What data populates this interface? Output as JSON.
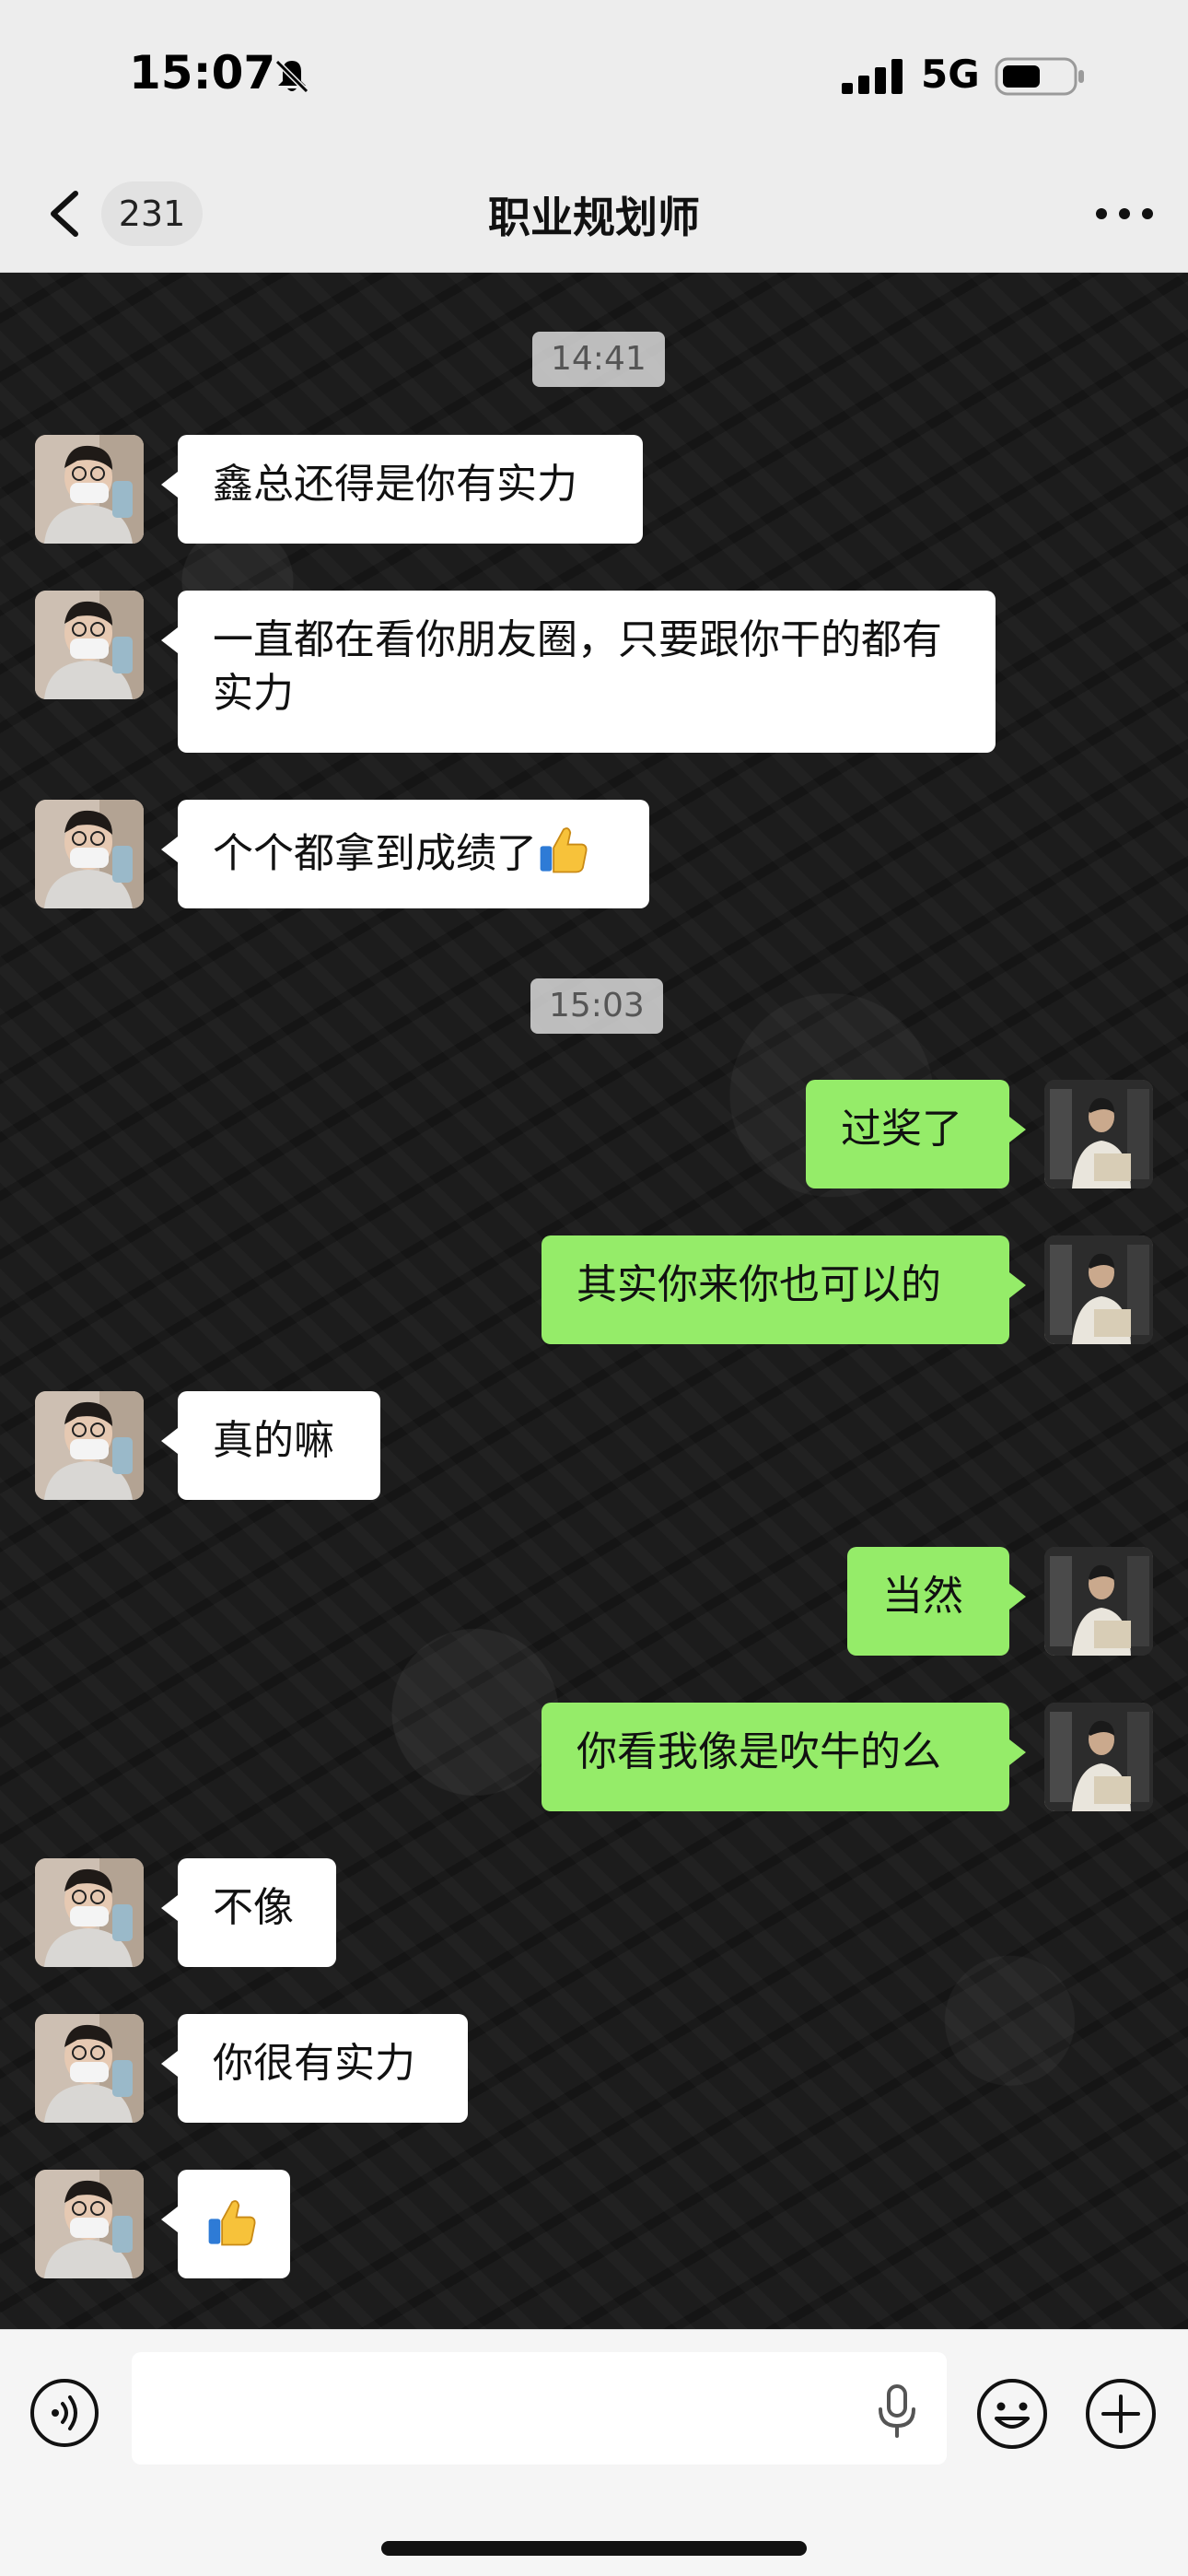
{
  "status_bar": {
    "time": "15:07",
    "network": "5G",
    "icons": [
      "bell-slash-icon",
      "signal-icon",
      "battery-icon"
    ]
  },
  "nav": {
    "unread_count": "231",
    "title": "职业规划师",
    "icons": [
      "chevron-left-icon",
      "more-dots-icon"
    ]
  },
  "chat": {
    "timestamps": [
      "14:41",
      "15:03"
    ],
    "messages": [
      {
        "from": "friend",
        "text": "鑫总还得是你有实力"
      },
      {
        "from": "friend",
        "text": "一直都在看你朋友圈，只要跟你干的都有实力"
      },
      {
        "from": "friend",
        "text": "个个都拿到成绩了",
        "emoji": "thumbs-up"
      },
      {
        "from": "self",
        "text": "过奖了"
      },
      {
        "from": "self",
        "text": "其实你来你也可以的"
      },
      {
        "from": "friend",
        "text": "真的嘛"
      },
      {
        "from": "self",
        "text": "当然"
      },
      {
        "from": "self",
        "text": "你看我像是吹牛的么"
      },
      {
        "from": "friend",
        "text": "不像"
      },
      {
        "from": "friend",
        "text": "你很有实力"
      },
      {
        "from": "friend",
        "text": "",
        "emoji": "thumbs-up"
      }
    ]
  },
  "input_bar": {
    "placeholder": "",
    "icons": [
      "voice-icon",
      "mic-icon",
      "emoji-icon",
      "plus-icon"
    ]
  },
  "colors": {
    "outgoing_bubble": "#95ec69",
    "incoming_bubble": "#ffffff",
    "header_bg": "#ededed"
  }
}
